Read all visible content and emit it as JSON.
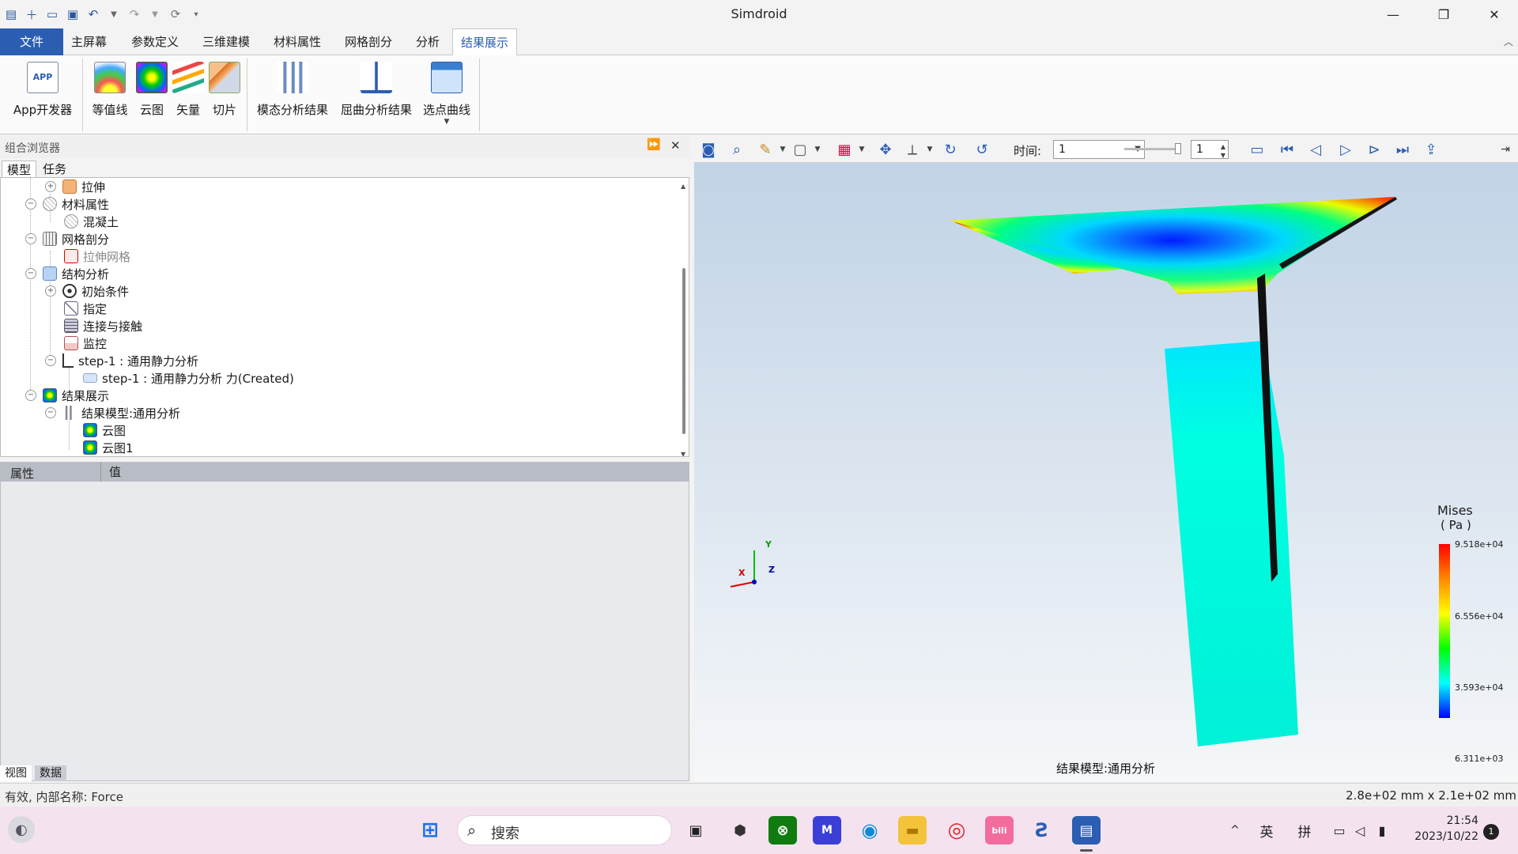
{
  "window": {
    "title": "Simdroid"
  },
  "ribbon_tabs": [
    {
      "label": "文件"
    },
    {
      "label": "主屏幕"
    },
    {
      "label": "参数定义"
    },
    {
      "label": "三维建模"
    },
    {
      "label": "材料属性"
    },
    {
      "label": "网格剖分"
    },
    {
      "label": "分析"
    },
    {
      "label": "结果展示"
    }
  ],
  "ribbon_buttons": [
    {
      "label": "App开发器",
      "icon": "app-icon"
    },
    {
      "label": "等值线",
      "icon": "contour-icon"
    },
    {
      "label": "云图",
      "icon": "cloud-map-icon"
    },
    {
      "label": "矢量",
      "icon": "vector-icon"
    },
    {
      "label": "切片",
      "icon": "slice-icon"
    },
    {
      "label": "模态分析结果",
      "icon": "modal-result-icon"
    },
    {
      "label": "屈曲分析结果",
      "icon": "buckling-result-icon"
    },
    {
      "label": "选点曲线",
      "icon": "point-curve-icon"
    }
  ],
  "browser": {
    "title": "组合浏览器",
    "tabs": [
      {
        "label": "模型"
      },
      {
        "label": "任务"
      }
    ],
    "tree": [
      {
        "label": "拉伸"
      },
      {
        "label": "材料属性"
      },
      {
        "label": "混凝土"
      },
      {
        "label": "网格剖分"
      },
      {
        "label": "拉伸网格"
      },
      {
        "label": "结构分析"
      },
      {
        "label": "初始条件"
      },
      {
        "label": "指定"
      },
      {
        "label": "连接与接触"
      },
      {
        "label": "监控"
      },
      {
        "label": "step-1 : 通用静力分析"
      },
      {
        "label": "step-1 : 通用静力分析 力(Created)"
      },
      {
        "label": "结果展示"
      },
      {
        "label": "结果模型:通用分析"
      },
      {
        "label": "云图"
      },
      {
        "label": "云图1"
      }
    ]
  },
  "props": {
    "col1": "属性",
    "col2": "值"
  },
  "bottom_tabs": [
    {
      "label": "视图"
    },
    {
      "label": "数据"
    }
  ],
  "viewer_toolbar": {
    "time_label": "时间:",
    "time_value": "1",
    "step_value": "1"
  },
  "viewport": {
    "caption": "结果模型:通用分析",
    "axes": {
      "x": "X",
      "y": "Y",
      "z": "Z"
    },
    "legend": {
      "title": "Mises",
      "unit": "( Pa )",
      "ticks": [
        "9.518e+04",
        "6.556e+04",
        "3.593e+04",
        "6.311e+03"
      ],
      "colors": [
        "#ff0000",
        "#ff8800",
        "#ffff00",
        "#00ff00",
        "#00ffff",
        "#0000ff"
      ]
    }
  },
  "status": {
    "left": "有效, 内部名称: Force",
    "right": "2.8e+02 mm x 2.1e+02 mm"
  },
  "taskbar": {
    "search_placeholder": "搜索",
    "ime1": "英",
    "ime2": "拼",
    "time": "21:54",
    "date": "2023/10/22",
    "notifications": "1"
  }
}
